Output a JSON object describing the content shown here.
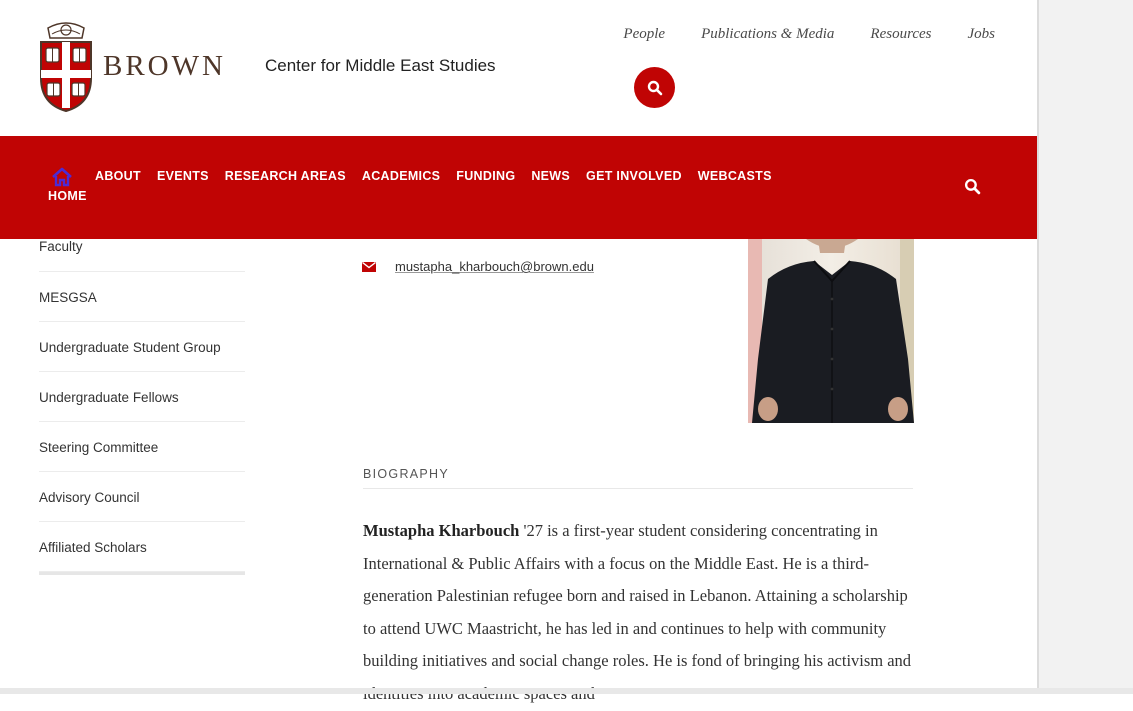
{
  "header": {
    "wordmark": "BROWN",
    "site_title": "Center for Middle East Studies",
    "utility_nav": [
      "People",
      "Publications & Media",
      "Resources",
      "Jobs"
    ]
  },
  "nav": {
    "home_label": "HOME",
    "items": [
      "ABOUT",
      "EVENTS",
      "RESEARCH AREAS",
      "ACADEMICS",
      "FUNDING",
      "NEWS",
      "GET INVOLVED",
      "WEBCASTS"
    ]
  },
  "sidebar": {
    "items": [
      "Faculty",
      "MESGSA",
      "Undergraduate Student Group",
      "Undergraduate Fellows",
      "Steering Committee",
      "Advisory Council",
      "Affiliated Scholars"
    ]
  },
  "profile": {
    "email": "mustapha_kharbouch@brown.edu",
    "bio_heading": "BIOGRAPHY",
    "bio_name": "Mustapha Kharbouch",
    "bio_text": " '27 is a first-year student considering concentrating in International & Public Affairs with a focus on the Middle East. He is a third-generation Palestinian refugee born and raised in Lebanon. Attaining a scholarship to attend UWC Maastricht, he has led in and continues to help with community building initiatives and social change roles. He is fond of bringing his activism and identities into academic spaces and"
  },
  "colors": {
    "brand_red": "#c00404",
    "brown": "#4e3629",
    "home_icon": "#4b2bd6"
  }
}
